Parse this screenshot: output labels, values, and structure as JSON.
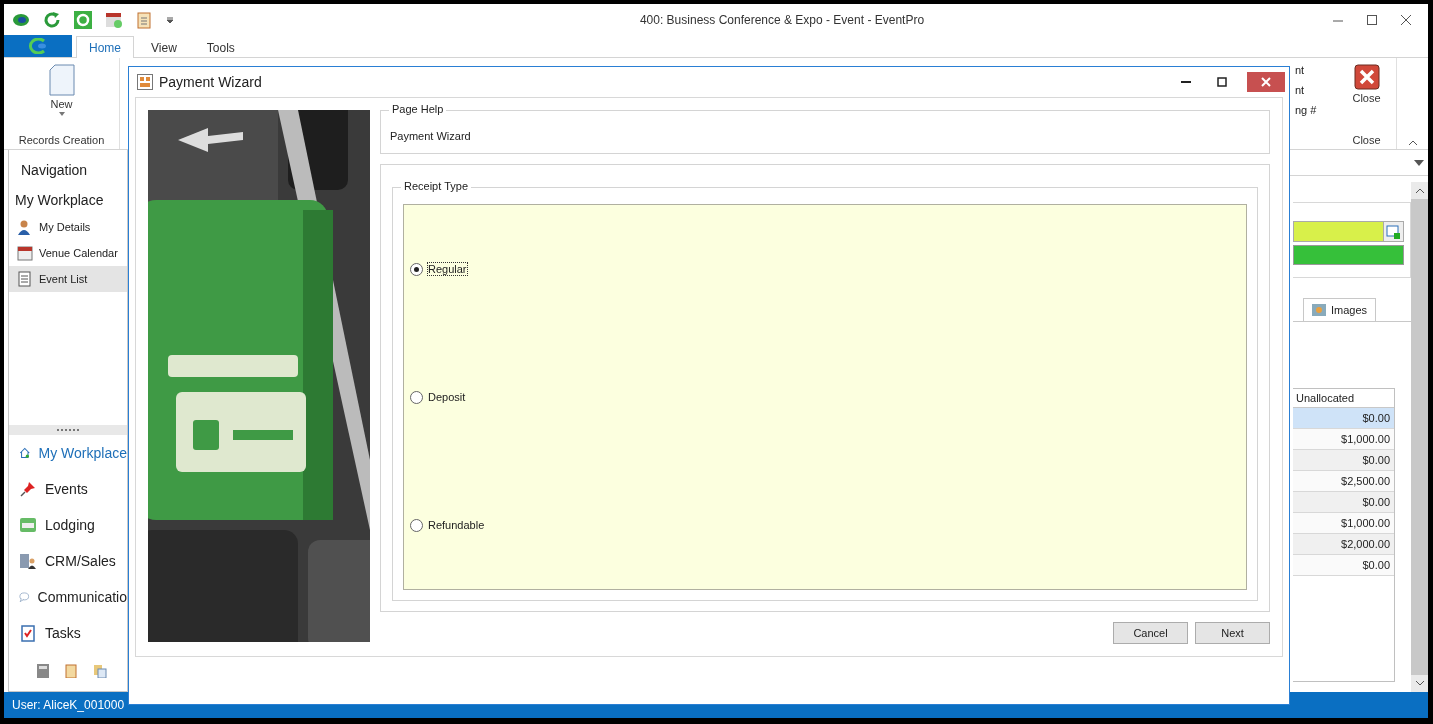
{
  "app": {
    "title": "400: Business Conference & Expo - Event - EventPro"
  },
  "ribbon_tabs": [
    {
      "label": "Home",
      "selected": true
    },
    {
      "label": "View",
      "selected": false
    },
    {
      "label": "Tools",
      "selected": false
    }
  ],
  "ribbon": {
    "new_label": "New",
    "group_label": "Records Creation",
    "peek_items": [
      "nt",
      "nt",
      "ng #"
    ],
    "close_label": "Close",
    "close_group_label": "Close"
  },
  "navigation": {
    "title": "Navigation",
    "workplace_title": "My Workplace",
    "items": [
      {
        "label": "My Details",
        "kind": "person",
        "selected": false
      },
      {
        "label": "Venue Calendar",
        "kind": "calendar",
        "selected": false
      },
      {
        "label": "Event List",
        "kind": "list",
        "selected": true
      }
    ],
    "sections": [
      {
        "label": "My Workplace",
        "kind": "home",
        "selected": true
      },
      {
        "label": "Events",
        "kind": "pin",
        "selected": false
      },
      {
        "label": "Lodging",
        "kind": "bed",
        "selected": false
      },
      {
        "label": "CRM/Sales",
        "kind": "building",
        "selected": false
      },
      {
        "label": "Communicatio",
        "kind": "bubble",
        "selected": false
      },
      {
        "label": "Tasks",
        "kind": "clipboard",
        "selected": false
      }
    ]
  },
  "right_panel": {
    "tab": "Images",
    "column": "Unallocated",
    "rows": [
      {
        "value": "$0.00",
        "selected": true
      },
      {
        "value": "$1,000.00",
        "selected": false
      },
      {
        "value": "$0.00",
        "selected": false
      },
      {
        "value": "$2,500.00",
        "selected": false
      },
      {
        "value": "$0.00",
        "selected": false
      },
      {
        "value": "$1,000.00",
        "selected": false
      },
      {
        "value": "$2,000.00",
        "selected": false
      },
      {
        "value": "$0.00",
        "selected": false
      }
    ]
  },
  "status_bar": {
    "user": "User: AliceK_001000"
  },
  "dialog": {
    "title": "Payment Wizard",
    "page_help_title": "Page Help",
    "page_help_text": "Payment Wizard",
    "receipt_group": "Receipt Type",
    "options": [
      {
        "label": "Regular",
        "selected": true
      },
      {
        "label": "Deposit",
        "selected": false
      },
      {
        "label": "Refundable",
        "selected": false
      }
    ],
    "buttons": [
      "Cancel",
      "Next"
    ]
  }
}
